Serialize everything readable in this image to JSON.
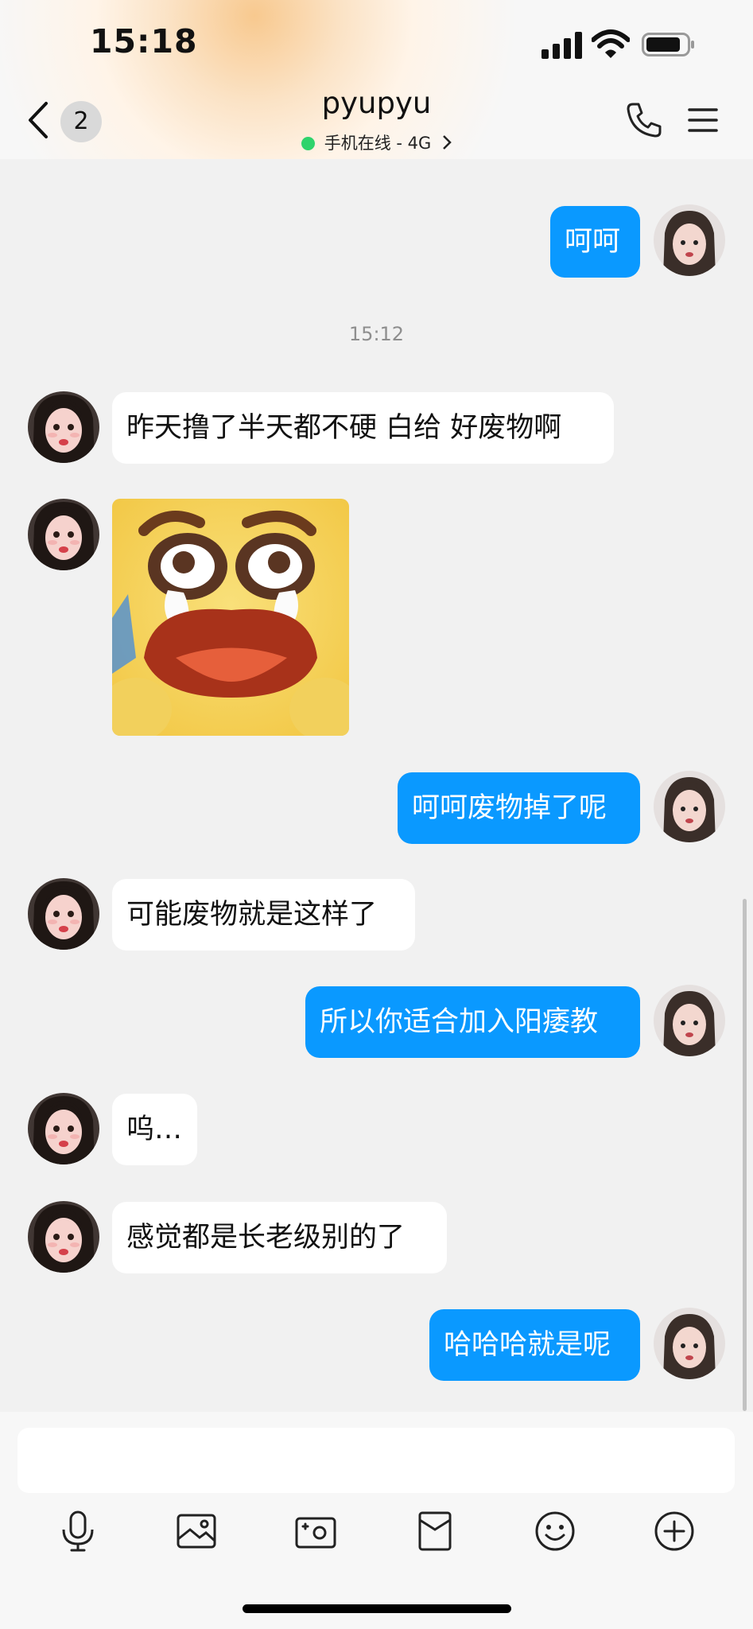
{
  "status_bar": {
    "time": "15:18"
  },
  "header": {
    "unread_count": "2",
    "contact_name": "pyupyu",
    "online_status": "手机在线 - 4G"
  },
  "messages": [
    {
      "sender": "me",
      "text": "呵呵"
    },
    {
      "type": "timestamp",
      "text": "15:12"
    },
    {
      "sender": "other",
      "text": "昨天撸了半天都不硬 白给 好废物啊"
    },
    {
      "sender": "other",
      "type": "sticker",
      "icon": "crying-face-sticker"
    },
    {
      "sender": "me",
      "text": "呵呵废物掉了呢"
    },
    {
      "sender": "other",
      "text": "可能废物就是这样了"
    },
    {
      "sender": "me",
      "text": "所以你适合加入阳痿教"
    },
    {
      "sender": "other",
      "text": "呜…"
    },
    {
      "sender": "other",
      "text": "感觉都是长老级别的了"
    },
    {
      "sender": "me",
      "text": "哈哈哈就是呢"
    }
  ],
  "toolbar": {
    "icons": [
      "microphone-icon",
      "image-icon",
      "camera-icon",
      "red-packet-icon",
      "emoji-icon",
      "plus-icon"
    ]
  },
  "colors": {
    "my_bubble": "#0a99ff",
    "other_bubble": "#ffffff",
    "background": "#f1f1f1",
    "online_dot": "#2fd36c"
  }
}
